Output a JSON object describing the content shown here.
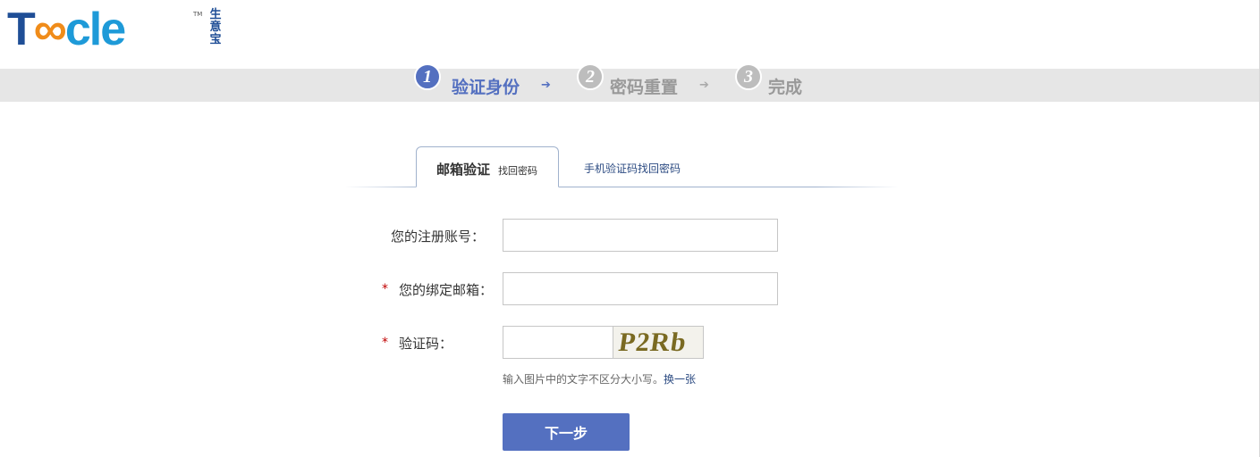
{
  "logo": {
    "word_t": "T",
    "word_infinity": "∞",
    "word_rest": "cle",
    "tm": "TM",
    "cn": "生意宝"
  },
  "steps": [
    {
      "num": "1",
      "label": "验证身份",
      "color": "#5470c0"
    },
    {
      "num": "2",
      "label": "密码重置",
      "color": "#999999"
    },
    {
      "num": "3",
      "label": "完成",
      "color": "#999999"
    }
  ],
  "step_arrow": "➔",
  "tabs": {
    "email": {
      "strong": "邮箱验证",
      "small": "找回密码"
    },
    "phone": {
      "label": "手机验证码找回密码"
    }
  },
  "form": {
    "account_label": "您的注册账号：",
    "email_label": "您的绑定邮箱：",
    "captcha_label": "验证码：",
    "required_mark": "*",
    "account_value": "",
    "email_value": "",
    "captcha_value": "",
    "captcha_image_text": "P2Rb",
    "hint": "输入图片中的文字不区分大小写。",
    "refresh_link": "换一张",
    "next_button": "下一步"
  }
}
